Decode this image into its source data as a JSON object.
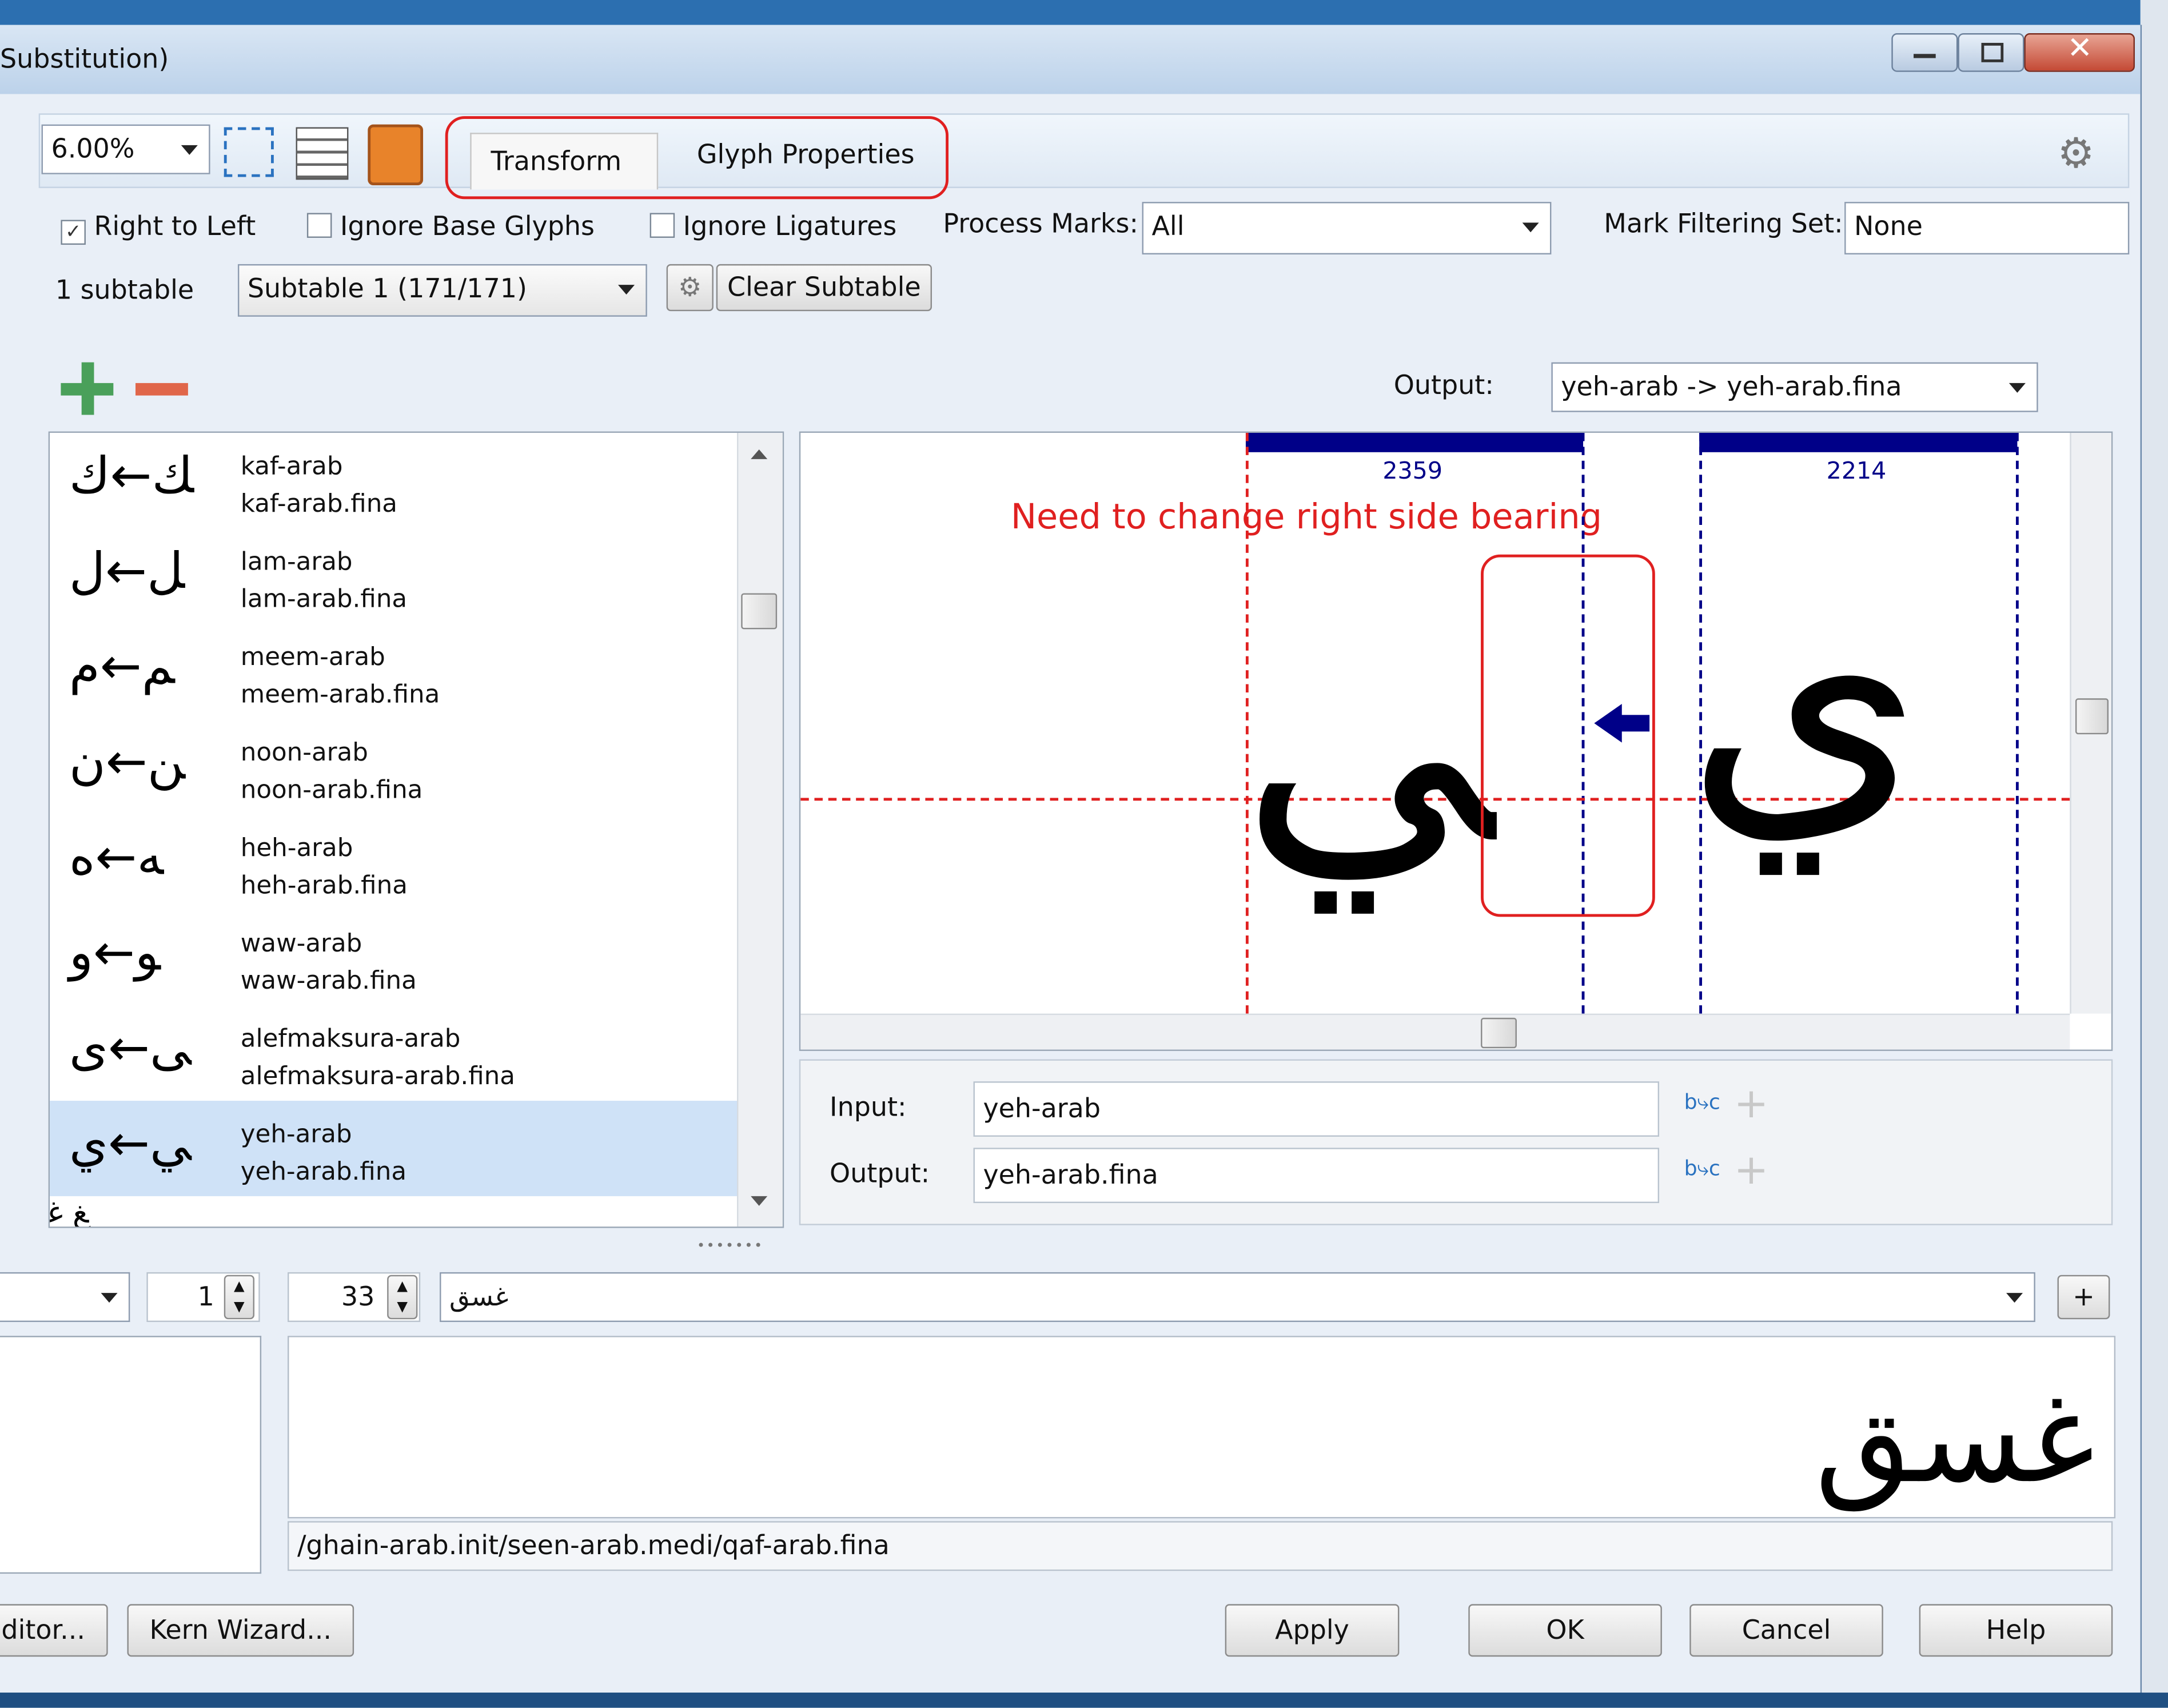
{
  "window": {
    "title": "Substitution)",
    "controls": [
      "minimize",
      "restore",
      "close"
    ]
  },
  "toolbar": {
    "zoom": "6.00%",
    "tabs": [
      {
        "label": "Transform",
        "selected": true
      },
      {
        "label": "Glyph Properties",
        "selected": false
      }
    ],
    "annotation_outline_color": "#e02020"
  },
  "options": {
    "right_to_left": {
      "label": "Right to Left",
      "checked": true
    },
    "ignore_base_glyphs": {
      "label": "Ignore Base Glyphs",
      "checked": false
    },
    "ignore_ligatures": {
      "label": "Ignore Ligatures",
      "checked": false
    },
    "process_marks": {
      "label": "Process Marks:",
      "value": "All"
    },
    "mark_filtering_set": {
      "label": "Mark Filtering Set:",
      "value": "None"
    }
  },
  "subtable": {
    "count_label": "1 subtable",
    "selected": "Subtable 1 (171/171)",
    "clear_label": "Clear Subtable"
  },
  "output_select": {
    "label": "Output:",
    "value": "yeh-arab -> yeh-arab.fina"
  },
  "glyph_list": [
    {
      "input": "kaf-arab",
      "output": "kaf-arab.fina",
      "glyph": "ﻚ←ﻙ",
      "selected": false
    },
    {
      "input": "lam-arab",
      "output": "lam-arab.fina",
      "glyph": "ﻞ←ﻝ",
      "selected": false
    },
    {
      "input": "meem-arab",
      "output": "meem-arab.fina",
      "glyph": "ﻢ←ﻡ",
      "selected": false
    },
    {
      "input": "noon-arab",
      "output": "noon-arab.fina",
      "glyph": "ﻦ←ﻥ",
      "selected": false
    },
    {
      "input": "heh-arab",
      "output": "heh-arab.fina",
      "glyph": "ﻪ←ﻩ",
      "selected": false
    },
    {
      "input": "waw-arab",
      "output": "waw-arab.fina",
      "glyph": "ﻮ←ﻭ",
      "selected": false
    },
    {
      "input": "alefmaksura-arab",
      "output": "alefmaksura-arab.fina",
      "glyph": "ﻰ←ﻯ",
      "selected": false
    },
    {
      "input": "yeh-arab",
      "output": "yeh-arab.fina",
      "glyph": "ﻲ←ﻱ",
      "selected": true
    }
  ],
  "preview": {
    "left_advance": "2359",
    "right_advance": "2214",
    "left_glyph": "ﻲ",
    "right_glyph": "ﻱ",
    "note": "Need to change right side bearing",
    "note_color": "#e02020",
    "guide_red": "#e02020",
    "guide_blue": "#000088"
  },
  "io": {
    "input_label": "Input:",
    "input_value": "yeh-arab",
    "output_label": "Output:",
    "output_value": "yeh-arab.fina"
  },
  "test_area": {
    "start": "1",
    "size": "33",
    "text": "غسق",
    "add_label": "+",
    "rendered": "غسق",
    "glyph_path": "/ghain-arab.init/seen-arab.medi/qaf-arab.fina"
  },
  "footer": {
    "editor_label": "ditor...",
    "kern_wizard_label": "Kern Wizard...",
    "apply_label": "Apply",
    "ok_label": "OK",
    "cancel_label": "Cancel",
    "help_label": "Help"
  }
}
